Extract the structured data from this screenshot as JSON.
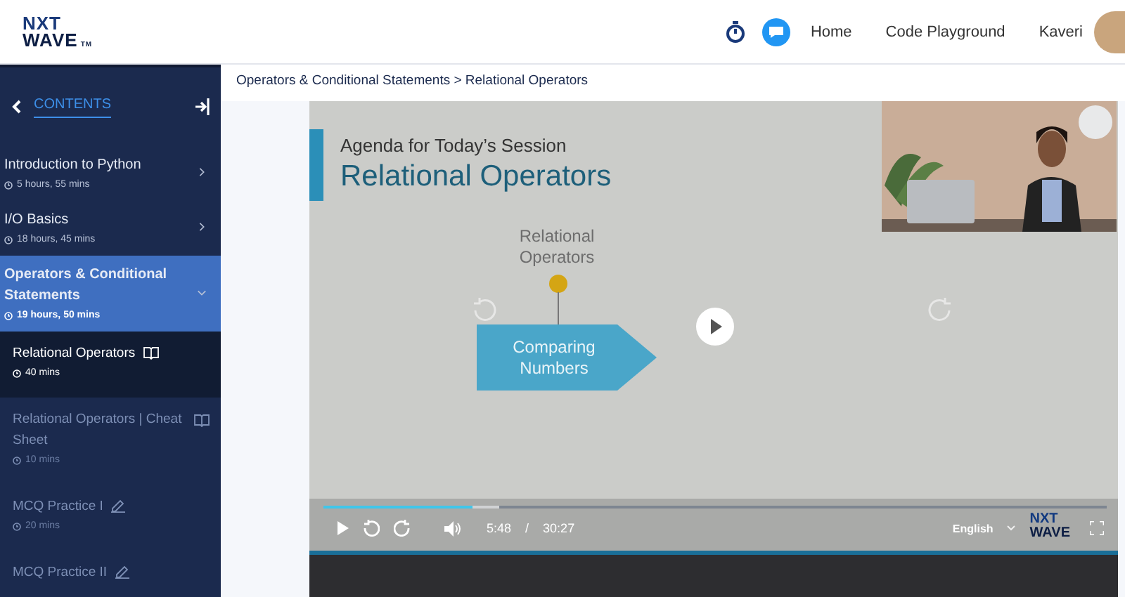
{
  "header": {
    "logo": [
      "NXT",
      "WAVE"
    ],
    "logo_mark": "TM",
    "nav": [
      "Home",
      "Code Playground"
    ],
    "user": "Kaveri"
  },
  "sidebar": {
    "title": "CONTENTS",
    "modules": [
      {
        "title": "Introduction to Python",
        "duration": "5 hours, 55 mins",
        "expanded": false,
        "selected": false
      },
      {
        "title": "I/O Basics",
        "duration": "18 hours, 45 mins",
        "expanded": false,
        "selected": false
      },
      {
        "title": "Operators & Conditional Statements",
        "duration": "19 hours, 50 mins",
        "expanded": true,
        "selected": true,
        "children": [
          {
            "title": "Relational Operators",
            "duration": "40 mins",
            "kind": "reading",
            "selected": true
          },
          {
            "title": "Relational Operators | Cheat Sheet",
            "duration": "10 mins",
            "kind": "reading",
            "selected": false
          },
          {
            "title": "MCQ Practice I",
            "duration": "20 mins",
            "kind": "practice",
            "selected": false
          },
          {
            "title": "MCQ Practice II",
            "kind": "practice",
            "selected": false
          }
        ]
      }
    ]
  },
  "breadcrumb": "Operators & Conditional Statements > Relational Operators",
  "video": {
    "slide": {
      "subtitle": "Agenda for Today’s Session",
      "title": "Relational Operators",
      "node_label": "Relational Operators",
      "box_label": "Comparing Numbers"
    },
    "progress": {
      "level": 0.19
    },
    "time": "5:48",
    "time_separator": "/",
    "duration": "30:27",
    "language": "English",
    "watermark": [
      "NXT",
      "WAVE"
    ]
  }
}
